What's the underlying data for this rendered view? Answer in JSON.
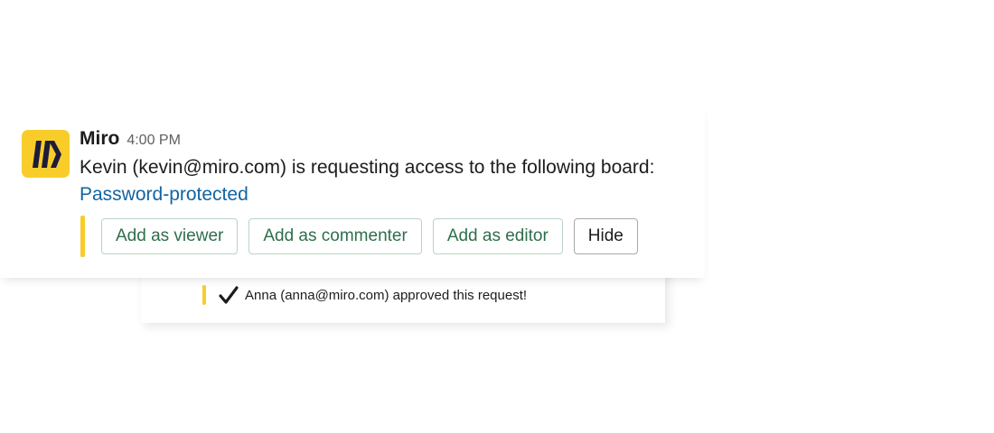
{
  "message": {
    "sender": "Miro",
    "timestamp": "4:00 PM",
    "text": "Kevin (kevin@miro.com) is requesting access to the following board:",
    "board_link": "Password-protected",
    "app_icon": "miro-logo-icon"
  },
  "actions": {
    "viewer_label": "Add as viewer",
    "commenter_label": "Add as commenter",
    "editor_label": "Add as editor",
    "hide_label": "Hide"
  },
  "approval": {
    "icon": "check-icon",
    "text": "Anna (anna@miro.com) approved this request!"
  },
  "colors": {
    "accent_yellow": "#f8cd2a",
    "link_blue": "#1264a3",
    "button_green": "#2d6f4b"
  }
}
